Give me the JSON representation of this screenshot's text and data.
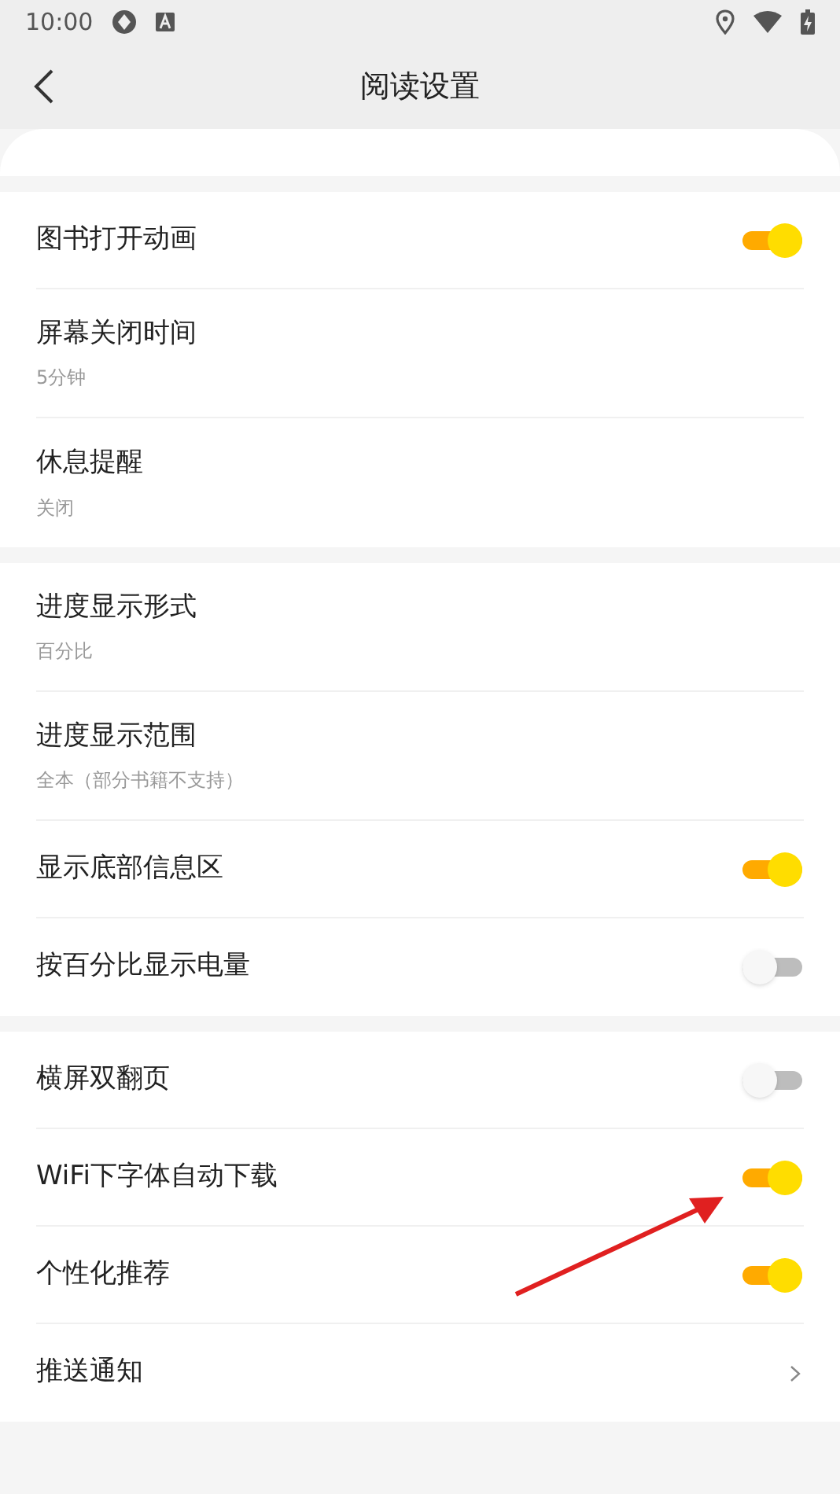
{
  "status_bar": {
    "time": "10:00"
  },
  "header": {
    "title": "阅读设置"
  },
  "sections": [
    {
      "rows": [
        {
          "kind": "toggle",
          "label": "图书打开动画",
          "on": true
        },
        {
          "kind": "value",
          "label": "屏幕关闭时间",
          "value": "5分钟"
        },
        {
          "kind": "value",
          "label": "休息提醒",
          "value": "关闭"
        }
      ]
    },
    {
      "rows": [
        {
          "kind": "value",
          "label": "进度显示形式",
          "value": "百分比"
        },
        {
          "kind": "value",
          "label": "进度显示范围",
          "value": "全本（部分书籍不支持）"
        },
        {
          "kind": "toggle",
          "label": "显示底部信息区",
          "on": true
        },
        {
          "kind": "toggle",
          "label": "按百分比显示电量",
          "on": false
        }
      ]
    },
    {
      "rows": [
        {
          "kind": "toggle",
          "label": "横屏双翻页",
          "on": false
        },
        {
          "kind": "toggle",
          "label": "WiFi下字体自动下载",
          "on": true
        },
        {
          "kind": "toggle",
          "label": "个性化推荐",
          "on": true
        },
        {
          "kind": "link",
          "label": "推送通知"
        }
      ]
    }
  ]
}
